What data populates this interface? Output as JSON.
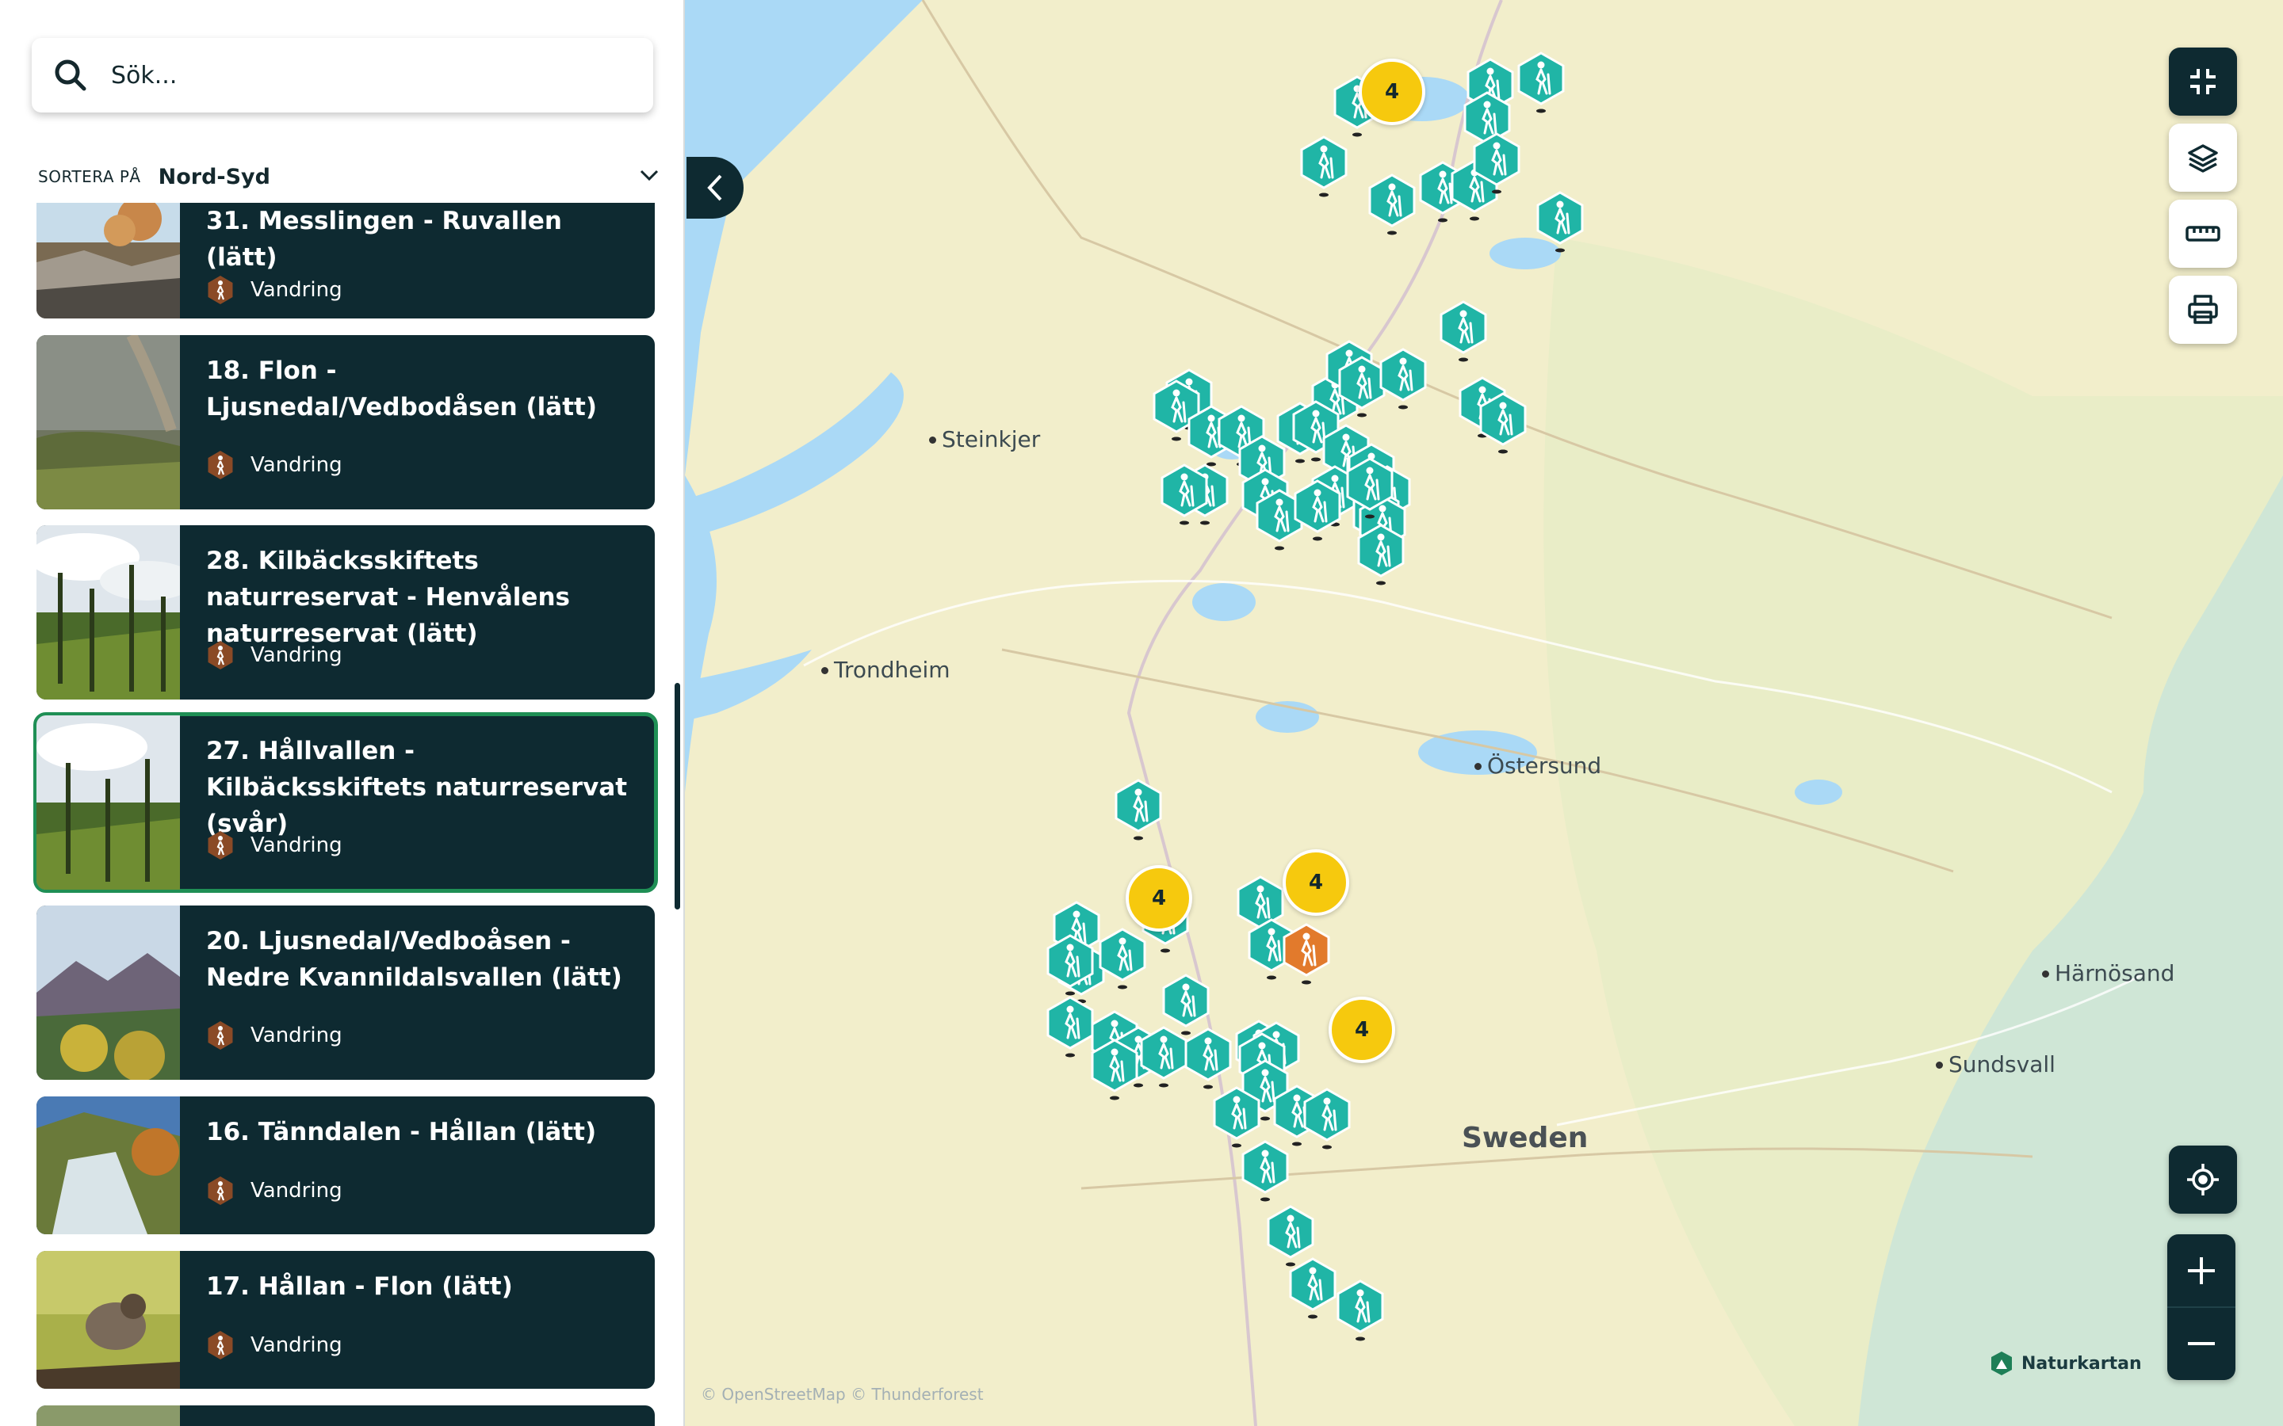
{
  "search": {
    "placeholder": "Sök..."
  },
  "sort": {
    "label": "SORTERA PÅ",
    "value": "Nord-Syd"
  },
  "trails": [
    {
      "title": "31. Messlingen - Ruvallen (lätt)",
      "tag": "Vandring"
    },
    {
      "title": "18. Flon - Ljusnedal/Vedbodåsen (lätt)",
      "tag": "Vandring"
    },
    {
      "title": "28. Kilbäcksskiftets naturreservat - Henvålens naturreservat (lätt)",
      "tag": "Vandring"
    },
    {
      "title": "27. Hållvallen - Kilbäcksskiftets naturreservat (svår)",
      "tag": "Vandring",
      "selected": true
    },
    {
      "title": "20. Ljusnedal/Vedboåsen - Nedre Kvannildalsvallen (lätt)",
      "tag": "Vandring"
    },
    {
      "title": "16. Tänndalen - Hållan (lätt)",
      "tag": "Vandring"
    },
    {
      "title": "17. Hållan - Flon (lätt)",
      "tag": "Vandring"
    }
  ],
  "map": {
    "places": [
      "Steinkjer",
      "Trondheim",
      "Östersund",
      "Härnösand",
      "Sundsvall"
    ],
    "country": "Sweden",
    "clusters": [
      "4",
      "4",
      "4",
      "4"
    ],
    "attribution": "© OpenStreetMap © Thunderforest",
    "brand": "Naturkartan",
    "colors": {
      "marker": "#20b5a6",
      "selected_marker": "#e27a2c",
      "cluster": "#f6c90e",
      "dark": "#0e2a31",
      "water": "#aad9f6",
      "land": "#f3eecb"
    }
  },
  "controls": [
    "collapse-icon",
    "layers-icon",
    "ruler-icon",
    "print-icon",
    "locate-icon",
    "zoom-in-icon",
    "zoom-out-icon"
  ]
}
